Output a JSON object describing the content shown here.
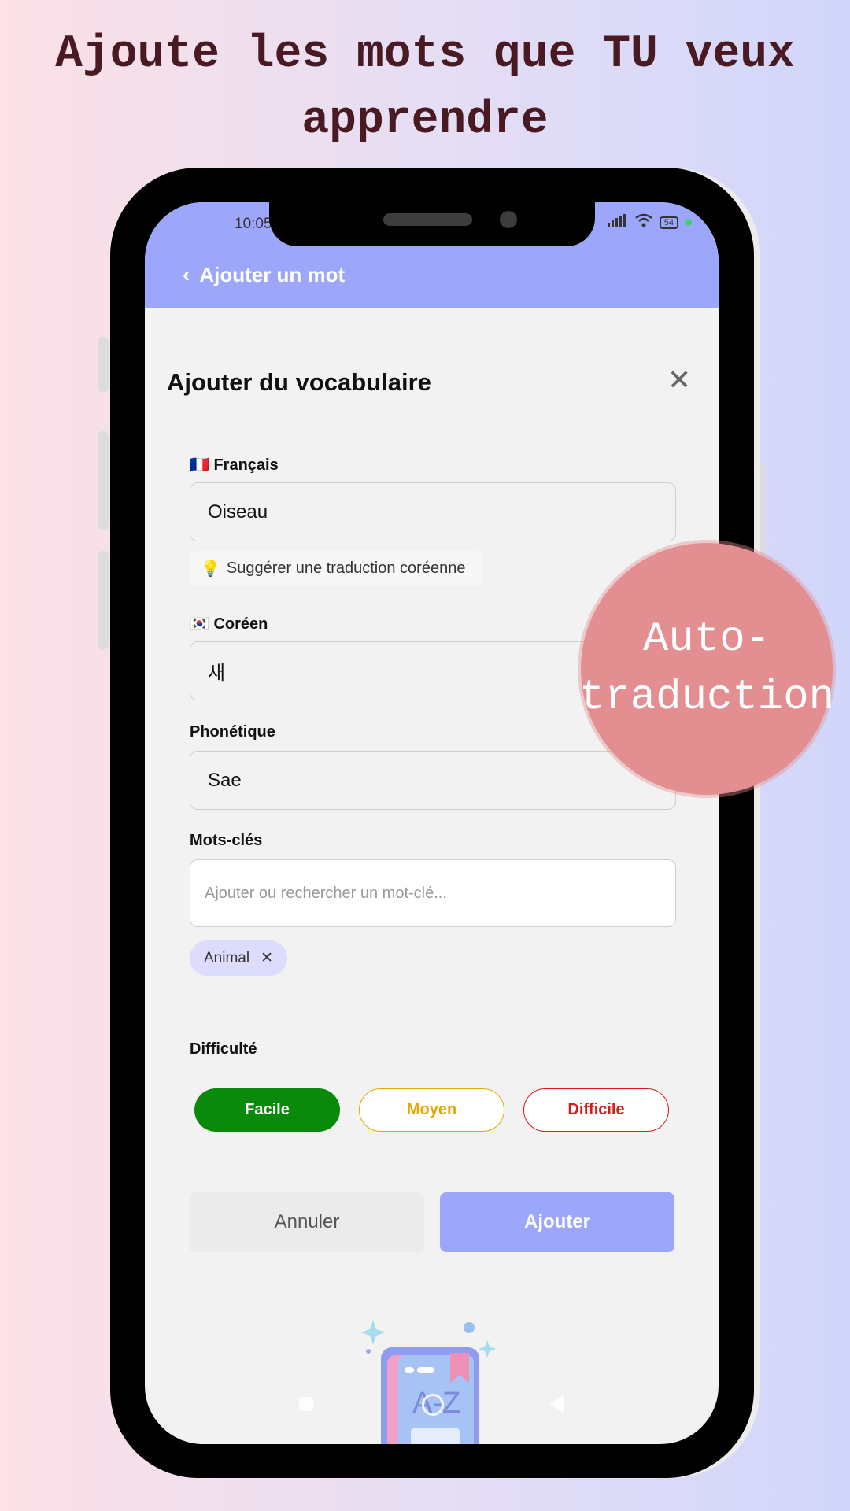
{
  "headline": {
    "line1": "Ajoute les mots que TU veux",
    "line2": "apprendre"
  },
  "badge": {
    "line1": "Auto-",
    "line2": "traduction"
  },
  "status_bar": {
    "time": "10:05",
    "battery": "54"
  },
  "app_bar": {
    "title": "Ajouter un mot"
  },
  "sheet": {
    "title": "Ajouter du vocabulaire",
    "french": {
      "flag": "🇫🇷",
      "label": "Français",
      "value": "Oiseau"
    },
    "suggest": {
      "icon": "lightbulb-icon",
      "text": "Suggérer une traduction coréenne"
    },
    "korean": {
      "flag": "🇰🇷",
      "label": "Coréen",
      "value": "새"
    },
    "phonetic": {
      "label": "Phonétique",
      "value": "Sae"
    },
    "keywords": {
      "label": "Mots-clés",
      "placeholder": "Ajouter ou rechercher un mot-clé...",
      "chips": [
        "Animal"
      ]
    },
    "difficulty": {
      "label": "Difficulté",
      "options": [
        {
          "label": "Facile",
          "color": "#0a8a0a",
          "selected": true
        },
        {
          "label": "Moyen",
          "color": "#e6a800",
          "selected": false
        },
        {
          "label": "Difficile",
          "color": "#d81b1b",
          "selected": false
        }
      ]
    },
    "cancel_label": "Annuler",
    "add_label": "Ajouter"
  },
  "illustration": {
    "text": "A-Z"
  },
  "colors": {
    "accent": "#9ca7fb",
    "badge": "#e38e91",
    "headline": "#4a1a22"
  }
}
